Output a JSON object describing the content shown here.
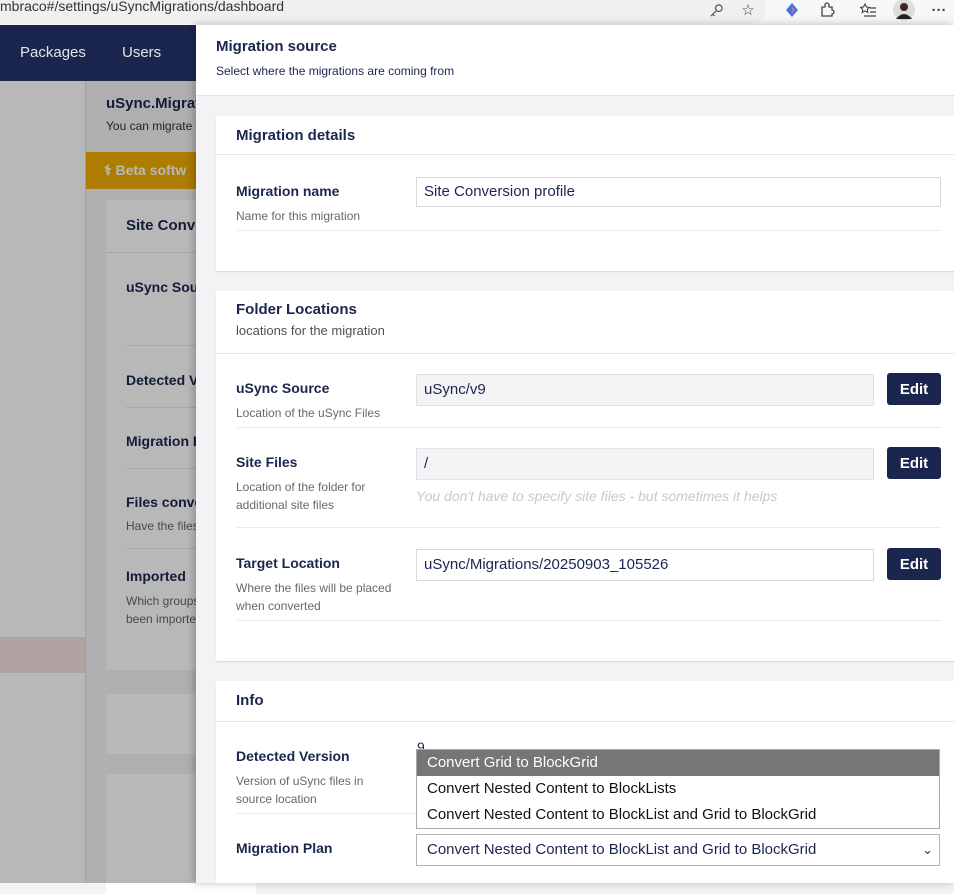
{
  "browser": {
    "url": "mbraco#/settings/uSyncMigrations/dashboard",
    "icons": [
      "key-icon",
      "star-icon",
      "copilot-icon",
      "extensions-icon",
      "favorites-icon",
      "profile-avatar",
      "more-icon"
    ]
  },
  "topnav": {
    "items": [
      "Packages",
      "Users"
    ]
  },
  "background": {
    "title": "uSync.Migrat",
    "subtitle": "You can migrate y",
    "beta": "Beta softw",
    "card_title": "Site Conve",
    "labels": [
      "uSync Sour",
      "Detected V",
      "Migration P",
      "Files conve",
      "Imported"
    ],
    "files_desc": "Have the files",
    "imported_desc": [
      "Which groups",
      "been importe"
    ]
  },
  "dialog": {
    "title": "Migration source",
    "subtitle": "Select where the migrations are coming from",
    "details": {
      "title": "Migration details",
      "name_label": "Migration name",
      "name_desc": "Name for this migration",
      "name_value": "Site Conversion profile"
    },
    "folders": {
      "title": "Folder Locations",
      "subtitle": "locations for the migration",
      "source_label": "uSync Source",
      "source_desc": "Location of the uSync Files",
      "source_value": "uSync/v9",
      "site_label": "Site Files",
      "site_desc": "Location of the folder for additional site files",
      "site_value": "/",
      "site_hint": "You don't have to specify site files - but sometimes it helps",
      "target_label": "Target Location",
      "target_desc": "Where the files will be placed when converted",
      "target_value": "uSync/Migrations/20250903_105526",
      "edit_label": "Edit"
    },
    "info": {
      "title": "Info",
      "detected_label": "Detected Version",
      "detected_desc": "Version of uSync files in source location",
      "detected_value": "9",
      "plan_label": "Migration Plan",
      "plan_selected": "Convert Nested Content to BlockList and Grid to BlockGrid",
      "plan_options": [
        "Convert Grid to BlockGrid",
        "Convert Nested Content to BlockLists",
        "Convert Nested Content to BlockList and Grid to BlockGrid"
      ],
      "highlighted_option": 0
    }
  }
}
